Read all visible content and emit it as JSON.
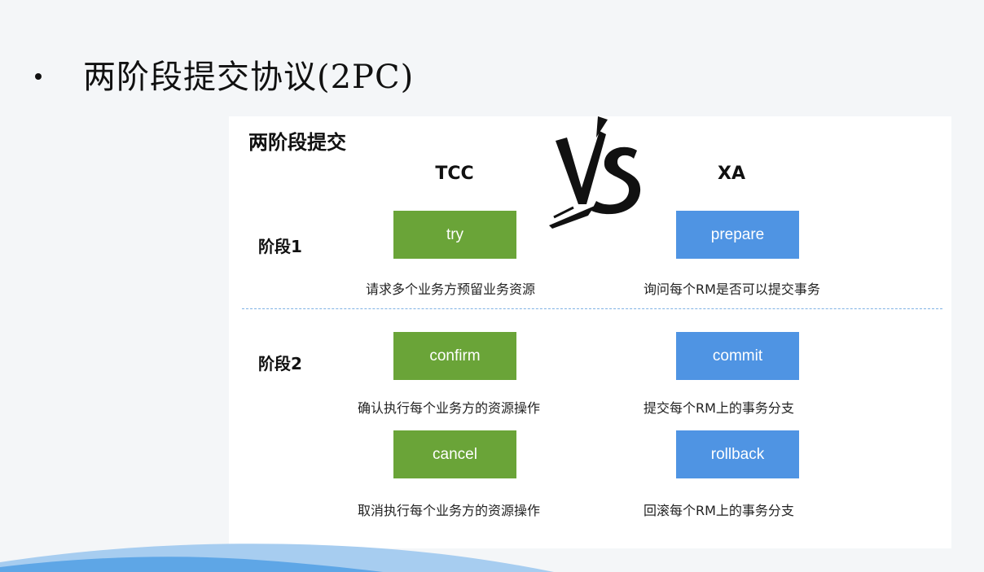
{
  "slide": {
    "title": "两阶段提交协议(2PC)"
  },
  "panel": {
    "title": "两阶段提交",
    "vs_logo": "VS",
    "columns": {
      "left": "TCC",
      "right": "XA"
    },
    "stages": [
      {
        "label": "阶段1"
      },
      {
        "label": "阶段2"
      }
    ],
    "tcc": {
      "try": {
        "label": "try",
        "desc": "请求多个业务方预留业务资源"
      },
      "confirm": {
        "label": "confirm",
        "desc": "确认执行每个业务方的资源操作"
      },
      "cancel": {
        "label": "cancel",
        "desc": "取消执行每个业务方的资源操作"
      }
    },
    "xa": {
      "prepare": {
        "label": "prepare",
        "desc": "询问每个RM是否可以提交事务"
      },
      "commit": {
        "label": "commit",
        "desc": "提交每个RM上的事务分支"
      },
      "rollback": {
        "label": "rollback",
        "desc": "回滚每个RM上的事务分支"
      }
    },
    "colors": {
      "tcc": "#6aa438",
      "xa": "#4f94e3",
      "divider": "#7fb2e5"
    }
  }
}
